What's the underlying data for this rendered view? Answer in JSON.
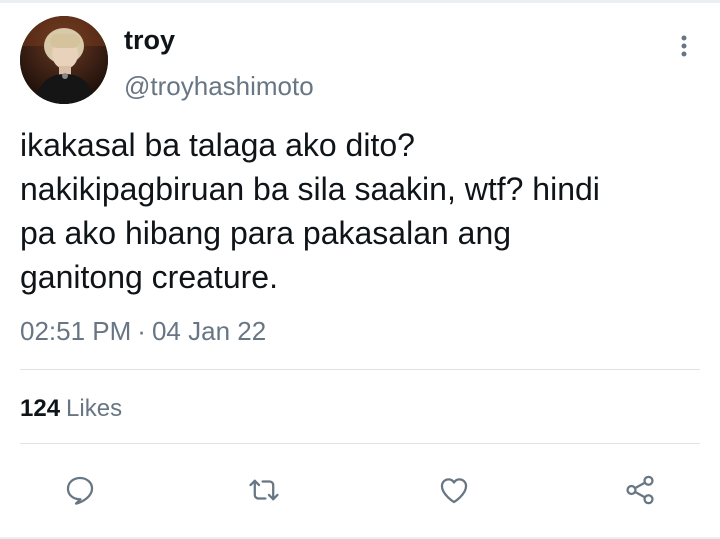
{
  "user": {
    "display_name": "troy",
    "handle": "@troyhashimoto"
  },
  "tweet": {
    "text": "ikakasal ba talaga ako dito?\nnakikipagbiruan ba sila saakin, wtf? hindi\npa ako hibang para pakasalan ang\nganitong creature.",
    "time": "02:51 PM",
    "separator": "·",
    "date": "04 Jan 22"
  },
  "stats": {
    "likes_count": "124",
    "likes_label": "Likes"
  },
  "actions": {
    "reply_icon": "reply-icon",
    "retweet_icon": "retweet-icon",
    "like_icon": "heart-icon",
    "share_icon": "share-icon",
    "more_icon": "more-vertical-icon"
  },
  "colors": {
    "text_primary": "#0f1419",
    "text_secondary": "#687684",
    "divider": "#dfe3e6"
  }
}
